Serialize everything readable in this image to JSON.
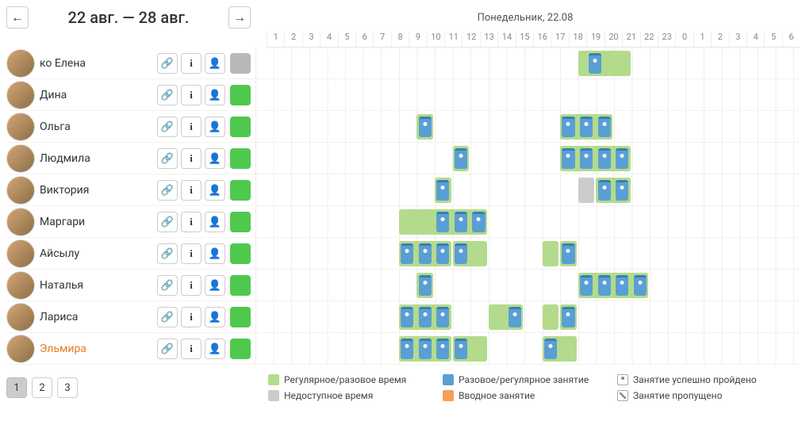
{
  "header": {
    "date_range": "22 авг. — 28 авг.",
    "day_title": "Понедельник, 22.08"
  },
  "hours": [
    "1",
    "2",
    "3",
    "4",
    "5",
    "6",
    "7",
    "8",
    "9",
    "10",
    "11",
    "12",
    "13",
    "14",
    "15",
    "16",
    "17",
    "18",
    "19",
    "20",
    "21",
    "22",
    "23",
    "0",
    "1",
    "2",
    "3",
    "4",
    "5",
    "6"
  ],
  "people": [
    {
      "name": "ко Елена",
      "status": "gray",
      "blocks": [
        {
          "c": "g",
          "s": 19,
          "w": 3
        },
        {
          "c": "b",
          "s": 19.6,
          "w": 0.8
        }
      ]
    },
    {
      "name": "Дина",
      "status": "green",
      "blocks": []
    },
    {
      "name": "Ольга",
      "status": "green",
      "blocks": [
        {
          "c": "g",
          "s": 10,
          "w": 1
        },
        {
          "c": "b",
          "s": 10.1,
          "w": 0.8
        },
        {
          "c": "g",
          "s": 18,
          "w": 3
        },
        {
          "c": "b",
          "s": 18.1,
          "w": 0.8
        },
        {
          "c": "b",
          "s": 19.1,
          "w": 0.8
        },
        {
          "c": "b",
          "s": 20.1,
          "w": 0.8
        }
      ]
    },
    {
      "name": "Людмила",
      "status": "green",
      "blocks": [
        {
          "c": "g",
          "s": 12,
          "w": 1
        },
        {
          "c": "b",
          "s": 12.1,
          "w": 0.8
        },
        {
          "c": "g",
          "s": 18,
          "w": 4
        },
        {
          "c": "b",
          "s": 18.1,
          "w": 0.8
        },
        {
          "c": "b",
          "s": 19.1,
          "w": 0.8
        },
        {
          "c": "b",
          "s": 20.1,
          "w": 0.8
        },
        {
          "c": "b",
          "s": 21.1,
          "w": 0.8
        }
      ]
    },
    {
      "name": "Виктория",
      "status": "green",
      "blocks": [
        {
          "c": "g",
          "s": 11,
          "w": 1
        },
        {
          "c": "b",
          "s": 11.1,
          "w": 0.8
        },
        {
          "c": "gy",
          "s": 19,
          "w": 1
        },
        {
          "c": "g",
          "s": 20,
          "w": 2
        },
        {
          "c": "b",
          "s": 20.1,
          "w": 0.8
        },
        {
          "c": "b",
          "s": 21.1,
          "w": 0.8
        }
      ]
    },
    {
      "name": "Маргари",
      "status": "green",
      "blocks": [
        {
          "c": "g",
          "s": 9,
          "w": 5
        },
        {
          "c": "b",
          "s": 11.1,
          "w": 0.8
        },
        {
          "c": "b",
          "s": 12.1,
          "w": 0.8
        },
        {
          "c": "b",
          "s": 13.1,
          "w": 0.8
        }
      ]
    },
    {
      "name": "Айсылу",
      "status": "green",
      "blocks": [
        {
          "c": "g",
          "s": 9,
          "w": 3
        },
        {
          "c": "b",
          "s": 9.1,
          "w": 0.8
        },
        {
          "c": "b",
          "s": 10.1,
          "w": 0.8
        },
        {
          "c": "b",
          "s": 11.1,
          "w": 0.8
        },
        {
          "c": "g",
          "s": 12,
          "w": 2
        },
        {
          "c": "b",
          "s": 12.1,
          "w": 0.8
        },
        {
          "c": "g",
          "s": 17,
          "w": 1
        },
        {
          "c": "g",
          "s": 18,
          "w": 1
        },
        {
          "c": "b",
          "s": 18.1,
          "w": 0.8
        }
      ]
    },
    {
      "name": "Наталья",
      "status": "green",
      "blocks": [
        {
          "c": "g",
          "s": 10,
          "w": 1
        },
        {
          "c": "b",
          "s": 10.1,
          "w": 0.8
        },
        {
          "c": "g",
          "s": 19,
          "w": 4
        },
        {
          "c": "b",
          "s": 19.1,
          "w": 0.8
        },
        {
          "c": "b",
          "s": 20.1,
          "w": 0.8
        },
        {
          "c": "b",
          "s": 21.1,
          "w": 0.8
        },
        {
          "c": "b",
          "s": 22.1,
          "w": 0.8
        }
      ]
    },
    {
      "name": "Лариса",
      "status": "green",
      "blocks": [
        {
          "c": "g",
          "s": 9,
          "w": 3
        },
        {
          "c": "b",
          "s": 9.1,
          "w": 0.8
        },
        {
          "c": "b",
          "s": 10.1,
          "w": 0.8
        },
        {
          "c": "b",
          "s": 11.1,
          "w": 0.8
        },
        {
          "c": "g",
          "s": 14,
          "w": 2
        },
        {
          "c": "b",
          "s": 15.1,
          "w": 0.8
        },
        {
          "c": "g",
          "s": 17,
          "w": 1
        },
        {
          "c": "g",
          "s": 18,
          "w": 1
        },
        {
          "c": "b",
          "s": 18.1,
          "w": 0.8
        }
      ]
    },
    {
      "name": "Эльмира",
      "status": "green",
      "hl": true,
      "blocks": [
        {
          "c": "g",
          "s": 9,
          "w": 3
        },
        {
          "c": "b",
          "s": 9.1,
          "w": 0.8
        },
        {
          "c": "b",
          "s": 10.1,
          "w": 0.8
        },
        {
          "c": "b",
          "s": 11.1,
          "w": 0.8
        },
        {
          "c": "g",
          "s": 12,
          "w": 2
        },
        {
          "c": "b",
          "s": 12.1,
          "w": 0.8
        },
        {
          "c": "g",
          "s": 17,
          "w": 2
        },
        {
          "c": "b",
          "s": 17.1,
          "w": 0.8
        }
      ]
    }
  ],
  "pages": [
    "1",
    "2",
    "3"
  ],
  "active_page": 0,
  "legend": {
    "regular_time": "Регулярное/разовое время",
    "unavailable": "Недоступное время",
    "regular_lesson": "Разовое/регулярное занятие",
    "intro_lesson": "Вводное занятие",
    "passed": "Занятие успешно пройдено",
    "missed": "Занятие пропущено"
  }
}
